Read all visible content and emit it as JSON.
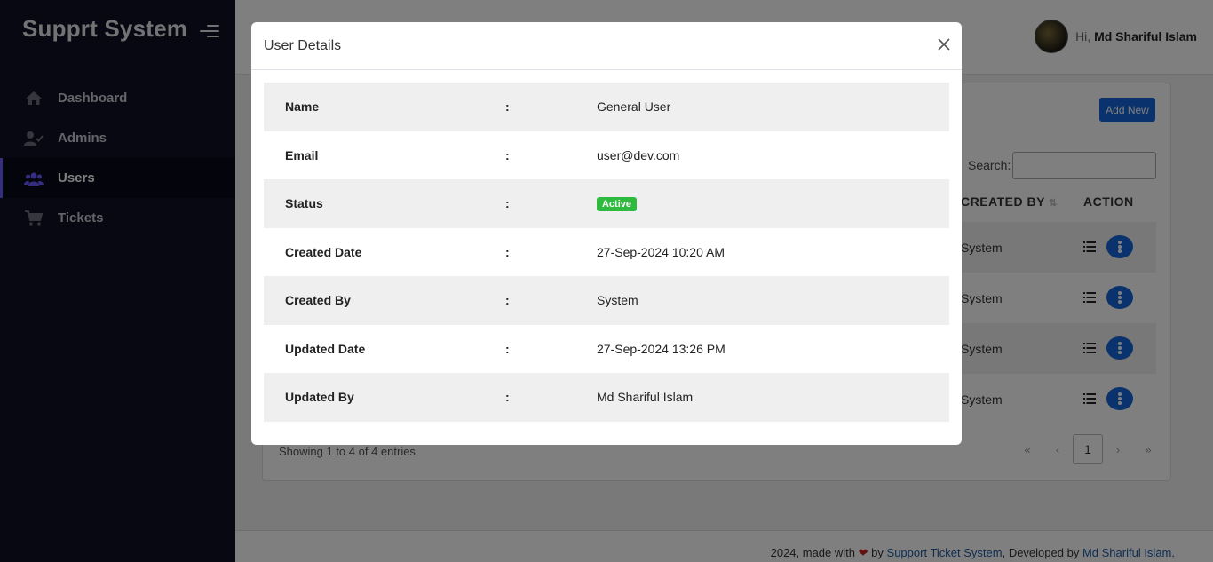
{
  "app": {
    "brand": "Supprt System"
  },
  "sidebar": {
    "items": [
      {
        "label": "Dashboard",
        "icon": "home-icon"
      },
      {
        "label": "Admins",
        "icon": "user-check-icon"
      },
      {
        "label": "Users",
        "icon": "users-icon",
        "active": true
      },
      {
        "label": "Tickets",
        "icon": "cart-icon"
      }
    ]
  },
  "header": {
    "greeting": "Hi,",
    "user_name": "Md Shariful Islam"
  },
  "list": {
    "add_button": "Add New",
    "search_label": "Search:",
    "columns": {
      "created_by": "CREATED BY",
      "action": "ACTION"
    },
    "rows": [
      {
        "created_by": "System"
      },
      {
        "created_by": "System"
      },
      {
        "created_by": "System"
      },
      {
        "created_by": "System"
      }
    ],
    "showing": "Showing 1 to 4 of 4 entries",
    "pagination": {
      "first": "«",
      "prev": "‹",
      "current": "1",
      "next": "›",
      "last": "»"
    }
  },
  "footer": {
    "prefix": "2024, made with",
    "by": "by",
    "system_link": "Support Ticket System",
    "developed_by": ", Developed by",
    "developer_link": "Md Shariful Islam",
    "suffix": "."
  },
  "modal": {
    "title": "User Details",
    "separator": ":",
    "fields": [
      {
        "label": "Name",
        "value": "General User"
      },
      {
        "label": "Email",
        "value": "user@dev.com"
      },
      {
        "label": "Status",
        "value": "Active"
      },
      {
        "label": "Created Date",
        "value": "27-Sep-2024 10:20 AM"
      },
      {
        "label": "Created By",
        "value": "System"
      },
      {
        "label": "Updated Date",
        "value": "27-Sep-2024 13:26 PM"
      },
      {
        "label": "Updated By",
        "value": "Md Shariful Islam"
      }
    ]
  },
  "colors": {
    "primary": "#1565d8",
    "sidebar": "#0e1022",
    "active_badge": "#2eba3d",
    "accent": "#6a5cff"
  }
}
